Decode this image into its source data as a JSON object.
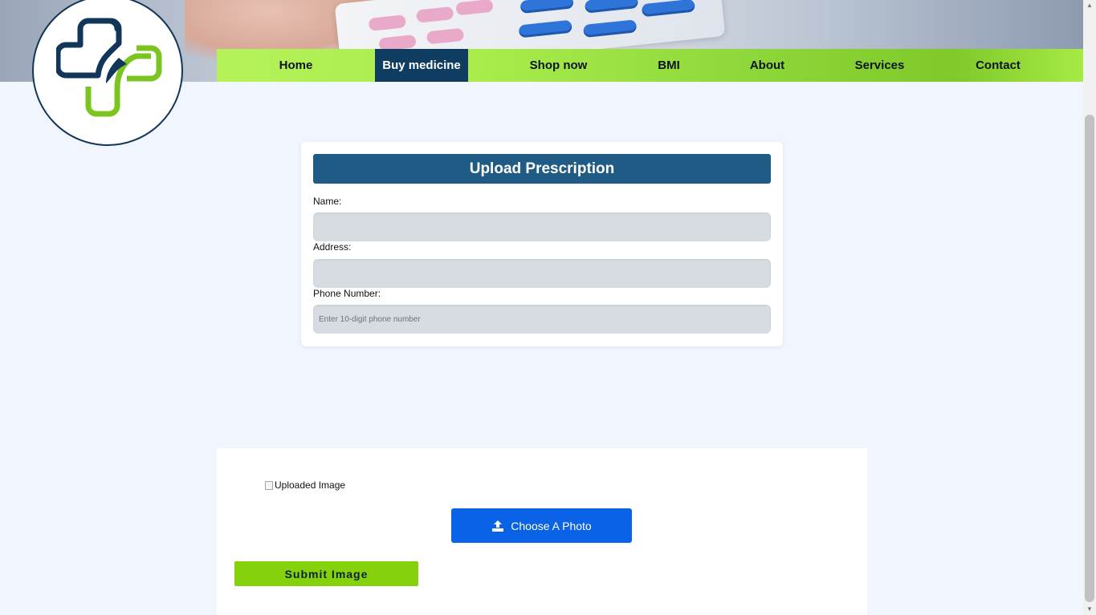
{
  "nav": {
    "items": [
      {
        "label": "Home"
      },
      {
        "label": "Buy medicine"
      },
      {
        "label": "Shop now"
      },
      {
        "label": "BMI"
      },
      {
        "label": "About"
      },
      {
        "label": "Services"
      },
      {
        "label": "Contact"
      }
    ],
    "active_index": 1
  },
  "form": {
    "title": "Upload Prescription",
    "name_label": "Name:",
    "name_value": "",
    "address_label": "Address:",
    "address_value": "",
    "phone_label": "Phone Number:",
    "phone_value": "",
    "phone_placeholder": "Enter 10-digit phone number"
  },
  "upload": {
    "image_alt": "Uploaded Image",
    "choose_label": "Choose A Photo",
    "submit_label": "Submit Image"
  },
  "colors": {
    "nav_active": "#0f3d62",
    "nav_green": "#a9ec4c",
    "form_header": "#205b86",
    "choose_button": "#0a62e6",
    "submit_button": "#84d10c",
    "logo_blue": "#12365a",
    "logo_green": "#7cc520"
  },
  "icons": {
    "logo": "medical-cross-logo",
    "upload": "upload-icon",
    "broken_image": "broken-image-icon"
  }
}
